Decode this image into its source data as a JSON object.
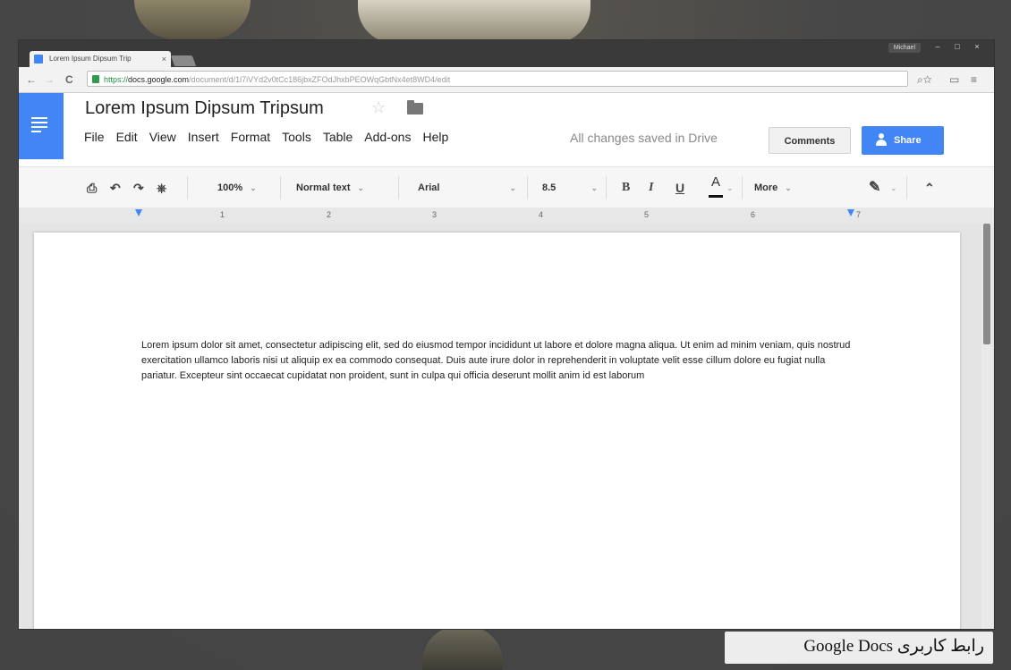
{
  "browser": {
    "tab_title": "Lorem Ipsum Dipsum Trip",
    "tab_close": "×",
    "user_label": "Michael",
    "controls": [
      "–",
      "□",
      "×"
    ],
    "url_scheme": "https://",
    "url_host": "docs.google.com",
    "url_path": "/document/d/1l7iVYd2v0tCc186jbxZFOdJhxbPEOWqGbtNx4et8WD4/edit",
    "nav": {
      "back": "←",
      "forward": "→",
      "reload": "C"
    },
    "right_icons": [
      "⌕☆",
      "▭",
      "≡"
    ]
  },
  "docs": {
    "title": "Lorem Ipsum Dipsum Tripsum",
    "star": "☆",
    "menu": [
      "File",
      "Edit",
      "View",
      "Insert",
      "Format",
      "Tools",
      "Table",
      "Add-ons",
      "Help"
    ],
    "save_status": "All changes saved in Drive",
    "comments_label": "Comments",
    "share_label": "Share"
  },
  "toolbar": {
    "zoom": "100%",
    "style": "Normal text",
    "font": "Arial",
    "size": "8.5",
    "bold": "B",
    "italic": "I",
    "underline": "U",
    "font_color": "A",
    "more": "More",
    "caret": "⌄",
    "collapse": "⌃"
  },
  "ruler": {
    "marks": [
      "1",
      "2",
      "3",
      "4",
      "5",
      "6",
      "7"
    ]
  },
  "document": {
    "body": "Lorem ipsum dolor sit amet, consectetur adipiscing elit, sed do eiusmod tempor incididunt ut labore et dolore magna aliqua. Ut enim ad minim veniam, quis nostrud exercitation ullamco laboris nisi ut aliquip ex ea commodo consequat. Duis aute irure dolor in reprehenderit in voluptate velit esse cillum dolore eu fugiat nulla pariatur. Excepteur sint occaecat cupidatat non proident, sunt in culpa qui officia deserunt mollit anim id est laborum"
  },
  "caption": "رابط کاربری Google Docs",
  "colors": {
    "docs_blue": "#4285f4",
    "secure_green": "#1e8e3e"
  }
}
